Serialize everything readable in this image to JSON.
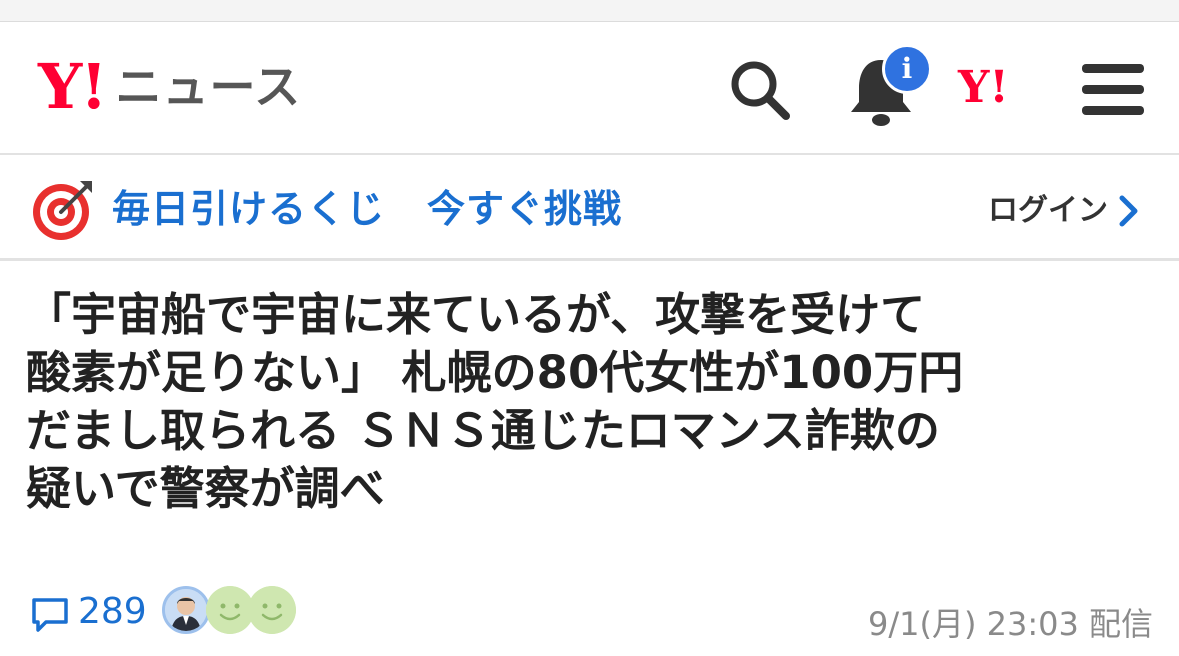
{
  "header": {
    "logo_mark": "Y!",
    "logo_text": "ニュース",
    "info_badge": "i",
    "yahoo_mark": "Y!",
    "icons": [
      "search-icon",
      "bell-icon",
      "info-icon",
      "yahoo-icon",
      "menu-icon"
    ]
  },
  "promo": {
    "text_part1": "毎日引けるくじ",
    "text_part2": "今すぐ挑戦",
    "login_label": "ログイン",
    "icons": [
      "target-icon",
      "chevron-right-icon"
    ]
  },
  "article": {
    "headline_lines": [
      "「宇宙船で宇宙に来ているが、攻撃を受けて",
      "酸素が足りない」 札幌の80代女性が100万円",
      "だまし取られる ＳＮＳ通じたロマンス詐欺の",
      "疑いで警察が調べ"
    ],
    "comment_count": "289",
    "date": "9/1(月) 23:03 配信"
  },
  "colors": {
    "brand_red": "#ff0033",
    "link_blue": "#1a6fd0",
    "badge_blue": "#2f72e0",
    "text_dark": "#222222",
    "meta_gray": "#8a8a8a"
  }
}
